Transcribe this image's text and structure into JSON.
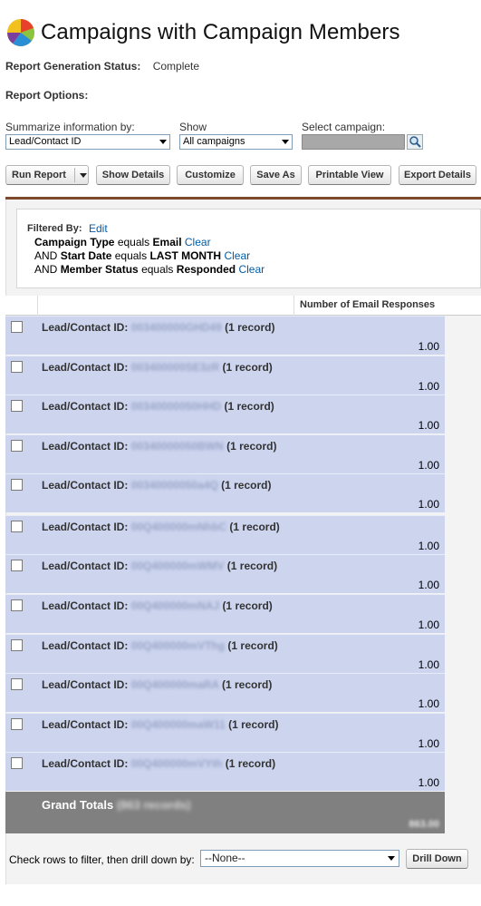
{
  "page": {
    "title": "Campaigns with Campaign Members",
    "status_label": "Report Generation Status:",
    "status_value": "Complete",
    "options_label": "Report Options:"
  },
  "controls": {
    "summarize_label": "Summarize information by:",
    "summarize_value": "Lead/Contact ID",
    "show_label": "Show",
    "show_value": "All campaigns",
    "campaign_label": "Select campaign:",
    "campaign_value": ""
  },
  "toolbar": {
    "run_report": "Run Report",
    "show_details": "Show Details",
    "customize": "Customize",
    "save_as": "Save As",
    "printable_view": "Printable View",
    "export_details": "Export Details"
  },
  "filters": {
    "heading": "Filtered By:",
    "edit": "Edit",
    "clear": "Clear",
    "lines": [
      {
        "prefix": "",
        "field": "Campaign Type",
        "op": "equals",
        "value": "Email"
      },
      {
        "prefix": "AND",
        "field": "Start Date",
        "op": "equals",
        "value": "LAST MONTH"
      },
      {
        "prefix": "AND",
        "field": "Member Status",
        "op": "equals",
        "value": "Responded"
      }
    ]
  },
  "table": {
    "column_header": "Number of Email Responses",
    "row_label": "Lead/Contact ID:",
    "rows": [
      {
        "id": "003400000GHD49",
        "count": "(1 record)",
        "value": "1.00"
      },
      {
        "id": "003400000SE3zR",
        "count": "(1 record)",
        "value": "1.00"
      },
      {
        "id": "00340000050HHD",
        "count": "(1 record)",
        "value": "1.00"
      },
      {
        "id": "00340000050BWN",
        "count": "(1 record)",
        "value": "1.00"
      },
      {
        "id": "00340000050a4Q",
        "count": "(1 record)",
        "value": "1.00"
      },
      {
        "id": "00Q400000mNhbC",
        "count": "(1 record)",
        "value": "1.00"
      },
      {
        "id": "00Q400000mWMV",
        "count": "(1 record)",
        "value": "1.00"
      },
      {
        "id": "00Q400000mNAJ",
        "count": "(1 record)",
        "value": "1.00"
      },
      {
        "id": "00Q400000mVThg",
        "count": "(1 record)",
        "value": "1.00"
      },
      {
        "id": "00Q400000maRA",
        "count": "(1 record)",
        "value": "1.00"
      },
      {
        "id": "00Q400000maW11",
        "count": "(1 record)",
        "value": "1.00"
      },
      {
        "id": "00Q400000mVYth",
        "count": "(1 record)",
        "value": "1.00"
      }
    ],
    "grand_label": "Grand Totals",
    "grand_count": "(863 records)",
    "grand_value": "863.00"
  },
  "drill": {
    "label": "Check rows to filter, then drill down by:",
    "value": "--None--",
    "button": "Drill Down"
  }
}
